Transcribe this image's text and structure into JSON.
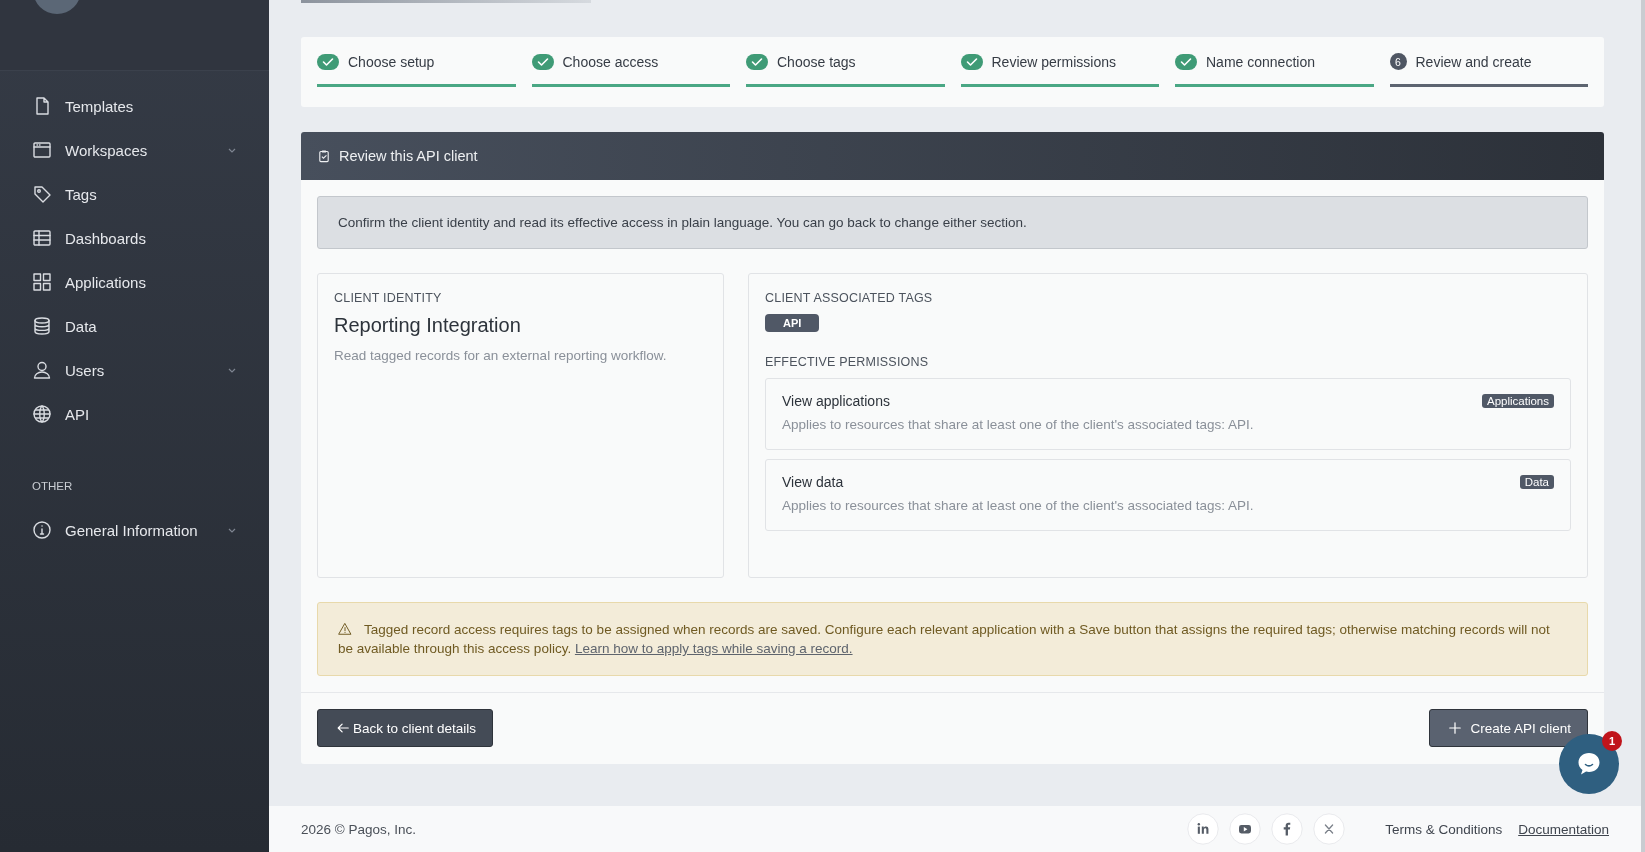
{
  "sidebar": {
    "items": [
      {
        "label": "Templates",
        "has_submenu": false
      },
      {
        "label": "Workspaces",
        "has_submenu": true
      },
      {
        "label": "Tags",
        "has_submenu": false
      },
      {
        "label": "Dashboards",
        "has_submenu": false
      },
      {
        "label": "Applications",
        "has_submenu": false
      },
      {
        "label": "Data",
        "has_submenu": false
      },
      {
        "label": "Users",
        "has_submenu": true
      },
      {
        "label": "API",
        "has_submenu": false
      }
    ],
    "section_label": "OTHER",
    "other_items": [
      {
        "label": "General Information",
        "has_submenu": true
      }
    ]
  },
  "stepper": [
    {
      "label": "Choose setup",
      "completed": true
    },
    {
      "label": "Choose access",
      "completed": true
    },
    {
      "label": "Choose tags",
      "completed": true
    },
    {
      "label": "Review permissions",
      "completed": true
    },
    {
      "label": "Name connection",
      "completed": true
    },
    {
      "label": "Review and create",
      "completed": false,
      "number": "6"
    }
  ],
  "panel": {
    "title": "Review this API client",
    "notice": "Confirm the client identity and read its effective access in plain language. You can go back to change either section.",
    "identity": {
      "heading": "CLIENT IDENTITY",
      "name": "Reporting Integration",
      "description": "Read tagged records for an external reporting workflow."
    },
    "tags": {
      "heading": "CLIENT ASSOCIATED TAGS",
      "items": [
        "API"
      ]
    },
    "permissions": {
      "heading": "EFFECTIVE PERMISSIONS",
      "items": [
        {
          "title": "View applications",
          "description": "Applies to resources that share at least one of the client's associated tags: API.",
          "badge": "Applications"
        },
        {
          "title": "View data",
          "description": "Applies to resources that share at least one of the client's associated tags: API.",
          "badge": "Data"
        }
      ]
    },
    "warning": {
      "text": "Tagged record access requires tags to be assigned when records are saved. Configure each relevant application with a Save button that assigns the required tags; otherwise matching records will not be available through this access policy.",
      "link": "Learn how to apply tags while saving a record."
    },
    "back_button": "Back to client details",
    "create_button": "Create API client"
  },
  "footer": {
    "copyright": "2026 © Pagos, Inc.",
    "links": [
      {
        "label": "Terms & Conditions",
        "underlined": false
      },
      {
        "label": "Documentation",
        "underlined": true
      }
    ]
  },
  "chat": {
    "badge": "1"
  }
}
